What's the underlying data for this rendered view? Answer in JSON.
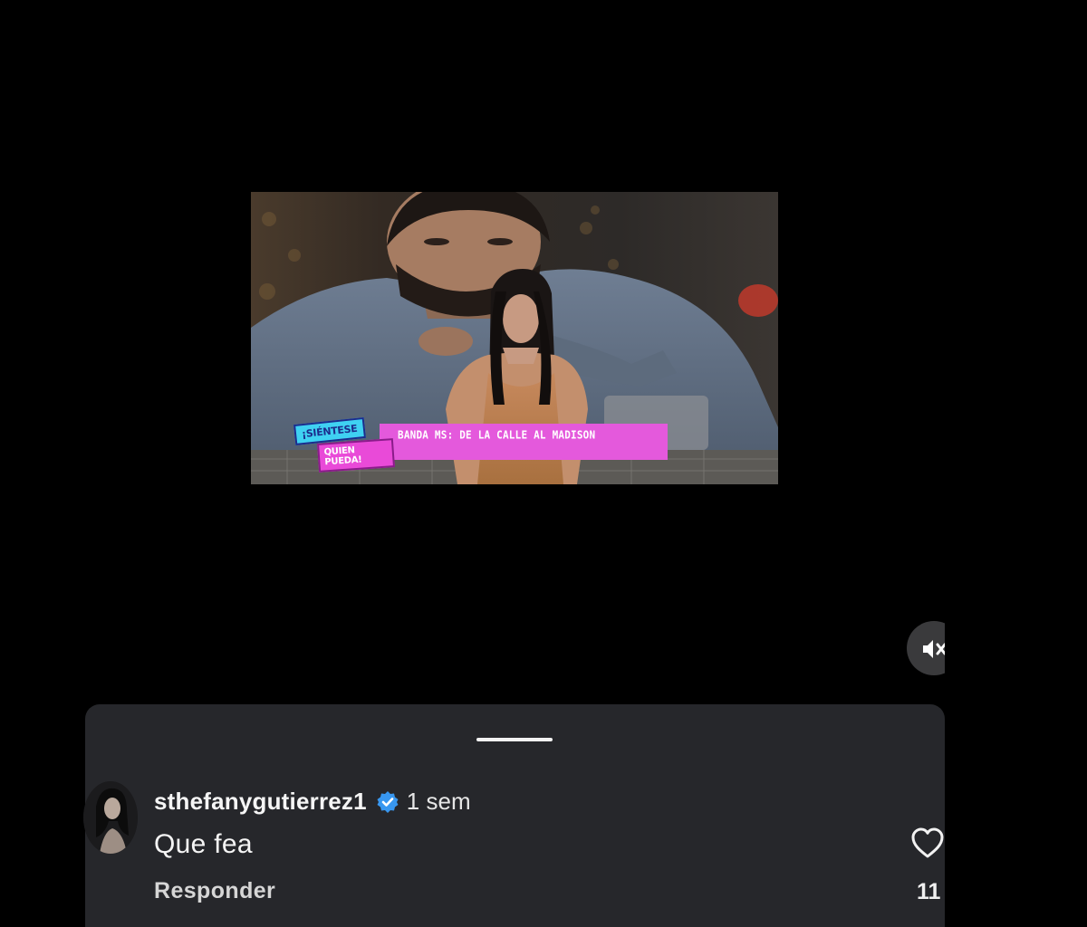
{
  "video": {
    "show_logo": {
      "line1": "¡SIÉNTESE",
      "line2": "QUIEN PUEDA!"
    },
    "headline": "BANDA MS: DE LA CALLE AL MADISON"
  },
  "controls": {
    "mute_icon": "speaker-muted-icon"
  },
  "comments": {
    "item": {
      "username": "sthefanygutierrez1",
      "verified_icon": "verified-badge-icon",
      "timestamp": "1 sem",
      "text": "Que fea",
      "reply_label": "Responder",
      "like_icon": "heart-outline-icon",
      "like_count": "11"
    }
  },
  "colors": {
    "background": "#000000",
    "sheet": "#26272b",
    "verified": "#3897f0",
    "lower_third": "#e459dc"
  }
}
